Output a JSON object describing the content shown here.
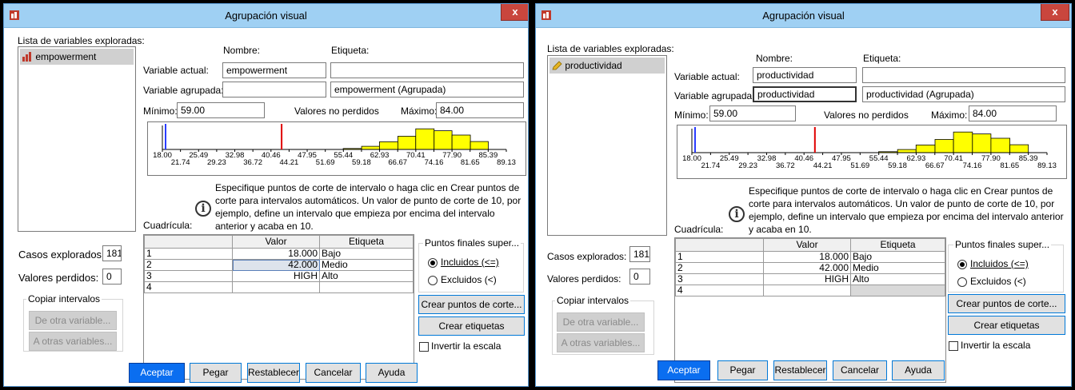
{
  "windows": [
    {
      "title": "Agrupación visual",
      "close_label": "x",
      "list_label": "Lista de variables exploradas:",
      "list_items": [
        "empowerment"
      ],
      "col_name": "Nombre:",
      "col_label": "Etiqueta:",
      "current_var_label": "Variable actual:",
      "current_var_name": "empowerment",
      "current_var_tag": "",
      "binned_var_label": "Variable agrupada:",
      "binned_var_name": "",
      "binned_var_tag": "empowerment (Agrupada)",
      "min_label": "Mínimo:",
      "min_value": "59.00",
      "nonmissing_label": "Valores no perdidos",
      "max_label": "Máximo:",
      "max_value": "84.00",
      "ticks_top": [
        "18.00",
        "25.49",
        "32.98",
        "40.46",
        "47.95",
        "55.44",
        "62.93",
        "70.41",
        "77.90",
        "85.39"
      ],
      "ticks_bottom": [
        "21.74",
        "29.23",
        "36.72",
        "44.21",
        "51.69",
        "59.18",
        "66.67",
        "74.16",
        "81.65",
        "89.13"
      ],
      "info_text": "Especifique puntos de corte de intervalo o haga clic en Crear puntos de corte para intervalos automáticos. Un valor de punto de corte de 10, por ejemplo, define un intervalo que empieza por encima del intervalo anterior y acaba en 10.",
      "grid_label": "Cuadrícula:",
      "grid_col_value": "Valor",
      "grid_col_label": "Etiqueta",
      "grid_rows": [
        {
          "n": "1",
          "value": "18.000",
          "label": "Bajo"
        },
        {
          "n": "2",
          "value": "42.000",
          "label": "Medio"
        },
        {
          "n": "3",
          "value": "HIGH",
          "label": "Alto"
        },
        {
          "n": "4",
          "value": "",
          "label": ""
        }
      ],
      "cases_label": "Casos explorados:",
      "cases_value": "181",
      "missing_label": "Valores perdidos:",
      "missing_value": "0",
      "copy_group": "Copiar intervalos",
      "from_other": "De otra variable...",
      "to_other": "A otras variables...",
      "endpoints_label": "Puntos finales super...",
      "included": "Incluidos (<=)",
      "excluded": "Excluidos (<)",
      "make_cutpoints": "Crear puntos de corte...",
      "make_labels": "Crear etiquetas",
      "reverse": "Invertir la escala",
      "btn_ok": "Aceptar",
      "btn_paste": "Pegar",
      "btn_reset": "Restablecer",
      "btn_cancel": "Cancelar",
      "btn_help": "Ayuda"
    },
    {
      "title": "Agrupación visual",
      "close_label": "x",
      "list_label": "Lista de variables exploradas:",
      "list_items": [
        "productividad"
      ],
      "col_name": "Nombre:",
      "col_label": "Etiqueta:",
      "current_var_label": "Variable actual:",
      "current_var_name": "productividad",
      "current_var_tag": "",
      "binned_var_label": "Variable agrupada:",
      "binned_var_name": "productividad",
      "binned_var_tag": "productividad (Agrupada)",
      "min_label": "Mínimo:",
      "min_value": "59.00",
      "nonmissing_label": "Valores no perdidos",
      "max_label": "Máximo:",
      "max_value": "84.00",
      "ticks_top": [
        "18.00",
        "25.49",
        "32.98",
        "40.46",
        "47.95",
        "55.44",
        "62.93",
        "70.41",
        "77.90",
        "85.39"
      ],
      "ticks_bottom": [
        "21.74",
        "29.23",
        "36.72",
        "44.21",
        "51.69",
        "59.18",
        "66.67",
        "74.16",
        "81.65",
        "89.13"
      ],
      "info_text": "Especifique puntos de corte de intervalo o haga clic en Crear puntos de corte para intervalos automáticos. Un valor de punto de corte de 10, por ejemplo, define un intervalo que empieza por encima del intervalo anterior y acaba en 10.",
      "grid_label": "Cuadrícula:",
      "grid_col_value": "Valor",
      "grid_col_label": "Etiqueta",
      "grid_rows": [
        {
          "n": "1",
          "value": "18.000",
          "label": "Bajo"
        },
        {
          "n": "2",
          "value": "42.000",
          "label": "Medio"
        },
        {
          "n": "3",
          "value": "HIGH",
          "label": "Alto"
        },
        {
          "n": "4",
          "value": "",
          "label": ""
        }
      ],
      "cases_label": "Casos explorados:",
      "cases_value": "181",
      "missing_label": "Valores perdidos:",
      "missing_value": "0",
      "copy_group": "Copiar intervalos",
      "from_other": "De otra variable...",
      "to_other": "A otras variables...",
      "endpoints_label": "Puntos finales super...",
      "included": "Incluidos (<=)",
      "excluded": "Excluidos (<)",
      "make_cutpoints": "Crear puntos de corte...",
      "make_labels": "Crear etiquetas",
      "reverse": "Invertir la escala",
      "btn_ok": "Aceptar",
      "btn_paste": "Pegar",
      "btn_reset": "Restablecer",
      "btn_cancel": "Cancelar",
      "btn_help": "Ayuda"
    }
  ],
  "histogram": {
    "axis_min": 18.0,
    "axis_max": 89.13,
    "cutpoints": [
      {
        "value": 18.0,
        "color": "#2a3cff"
      },
      {
        "value": 42.0,
        "color": "#e00000"
      }
    ],
    "bars": [
      {
        "from": 55.4,
        "to": 59.2,
        "height": 0.04
      },
      {
        "from": 59.2,
        "to": 62.9,
        "height": 0.13
      },
      {
        "from": 62.9,
        "to": 66.7,
        "height": 0.32
      },
      {
        "from": 66.7,
        "to": 70.4,
        "height": 0.55
      },
      {
        "from": 70.4,
        "to": 74.2,
        "height": 0.86
      },
      {
        "from": 74.2,
        "to": 77.9,
        "height": 0.78
      },
      {
        "from": 77.9,
        "to": 81.7,
        "height": 0.6
      },
      {
        "from": 81.7,
        "to": 85.4,
        "height": 0.33
      }
    ],
    "bar_color": "#ffff00"
  }
}
